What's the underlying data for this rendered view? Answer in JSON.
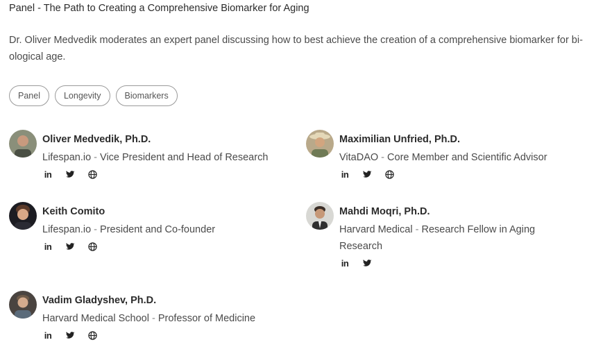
{
  "title": "Panel - The Path to Creating a Comprehensive Biomarker for Aging",
  "description": "Dr. Oliver Medvedik moderates an expert panel discussing how to best achieve the creation of a comprehensive biomarker for bi-ological age.",
  "tags": [
    "Panel",
    "Longevity",
    "Biomarkers"
  ],
  "separator": " - ",
  "speakers": [
    {
      "name": "Oliver Medvedik, Ph.D.",
      "org": "Lifespan.io",
      "role": "Vice President and Head of Research"
    },
    {
      "name": "Maximilian Unfried, Ph.D.",
      "org": "VitaDAO",
      "role": "Core Member and Scientific Advisor"
    },
    {
      "name": "Keith Comito",
      "org": "Lifespan.io",
      "role": "President and Co-founder"
    },
    {
      "name": "Mahdi Moqri, Ph.D.",
      "org": "Harvard Medical",
      "role": "Research Fellow in Aging Research"
    },
    {
      "name": "Vadim Gladyshev, Ph.D.",
      "org": "Harvard Medical School",
      "role": "Professor of Medicine"
    }
  ],
  "icons": {
    "linkedin": "linkedin-icon",
    "twitter": "twitter-icon",
    "website": "globe-icon"
  },
  "social_labels": {
    "linkedin": "in"
  }
}
